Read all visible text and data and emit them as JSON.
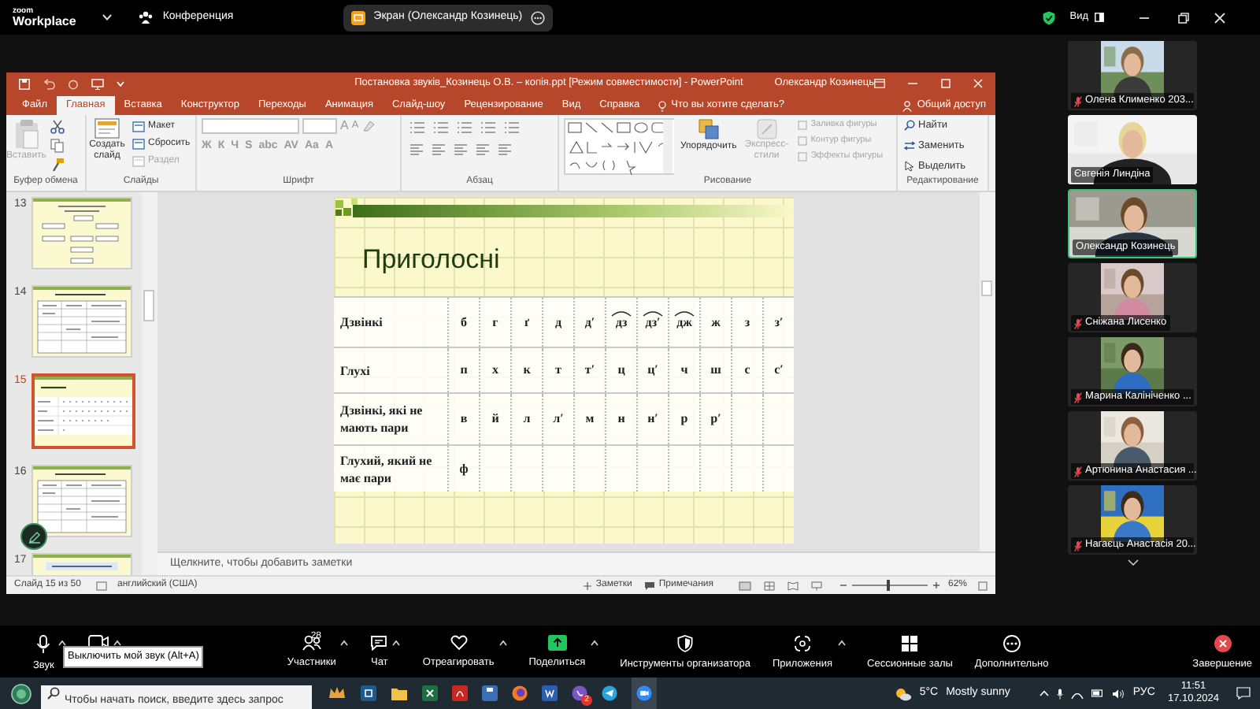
{
  "app_bar": {
    "logo_top": "zoom",
    "logo_bottom": "Workplace",
    "meeting_tab": "Конференция",
    "share_chip": "Экран (Олександр Козинець)",
    "view_button": "Вид"
  },
  "powerpoint": {
    "title": "Постановка звуків_Козинець О.В. – копія.ppt [Режим совместимости] - PowerPoint",
    "user": "Олександр Козинець",
    "tabs": [
      {
        "label": "Файл",
        "selected": false
      },
      {
        "label": "Главная",
        "selected": true
      },
      {
        "label": "Вставка",
        "selected": false
      },
      {
        "label": "Конструктор",
        "selected": false
      },
      {
        "label": "Переходы",
        "selected": false
      },
      {
        "label": "Анимация",
        "selected": false
      },
      {
        "label": "Слайд-шоу",
        "selected": false
      },
      {
        "label": "Рецензирование",
        "selected": false
      },
      {
        "label": "Вид",
        "selected": false
      },
      {
        "label": "Справка",
        "selected": false
      }
    ],
    "tell_me": "Что вы хотите сделать?",
    "share": "Общий доступ",
    "ribbon_groups": [
      {
        "kind": "clipboard",
        "label": "Буфер обмена",
        "paste": {
          "label": "Вставить",
          "disabled": true
        }
      },
      {
        "kind": "slides",
        "label": "Слайды",
        "new_slide": "Создать слайд",
        "items": [
          {
            "label": "Макет",
            "disabled": false
          },
          {
            "label": "Сбросить",
            "disabled": false
          },
          {
            "label": "Раздел",
            "disabled": true
          }
        ]
      },
      {
        "kind": "font",
        "label": "Шрифт",
        "size_buttons": [
          "A",
          "A"
        ],
        "format_buttons": [
          "Ж",
          "К",
          "Ч",
          "S",
          "abc",
          "AV",
          "Aa",
          "A"
        ]
      },
      {
        "kind": "paragraph",
        "label": "Абзац"
      },
      {
        "kind": "drawing",
        "label": "Рисование",
        "arrange": "Упорядочить",
        "quick_styles": {
          "label": "Экспресс-стили",
          "disabled": true
        },
        "items": [
          {
            "label": "Заливка фигуры",
            "disabled": true
          },
          {
            "label": "Контур фигуры",
            "disabled": true
          },
          {
            "label": "Эффекты фигуры",
            "disabled": true
          }
        ]
      },
      {
        "kind": "editing",
        "label": "Редактирование",
        "items": [
          {
            "label": "Найти",
            "disabled": false
          },
          {
            "label": "Заменить",
            "disabled": false
          },
          {
            "label": "Выделить",
            "disabled": false
          }
        ]
      }
    ],
    "thumbnails": [
      {
        "number": "13",
        "kind": "diagram",
        "selected": false
      },
      {
        "number": "14",
        "kind": "table",
        "selected": false
      },
      {
        "number": "15",
        "kind": "consonants",
        "selected": true
      },
      {
        "number": "16",
        "kind": "table",
        "selected": false
      },
      {
        "number": "17",
        "kind": "title",
        "selected": false
      }
    ],
    "slide": {
      "title": "Приголосні",
      "rows": [
        {
          "label": "Дзвінкі",
          "cells": [
            {
              "text": "б",
              "tie": false
            },
            {
              "text": "г",
              "tie": false
            },
            {
              "text": "ґ",
              "tie": false
            },
            {
              "text": "д",
              "tie": false
            },
            {
              "text": "д′",
              "tie": false
            },
            {
              "text": "дз",
              "tie": true
            },
            {
              "text": "дз′",
              "tie": true
            },
            {
              "text": "дж",
              "tie": true
            },
            {
              "text": "ж",
              "tie": false
            },
            {
              "text": "з",
              "tie": false
            },
            {
              "text": "з′",
              "tie": false
            }
          ]
        },
        {
          "label": "Глухі",
          "cells": [
            {
              "text": "п"
            },
            {
              "text": "х"
            },
            {
              "text": "к"
            },
            {
              "text": "т"
            },
            {
              "text": "т′"
            },
            {
              "text": "ц"
            },
            {
              "text": "ц′"
            },
            {
              "text": "ч"
            },
            {
              "text": "ш"
            },
            {
              "text": "с"
            },
            {
              "text": "с′"
            }
          ]
        },
        {
          "label": "Дзвінкі, які не мають пари",
          "cells": [
            {
              "text": "в"
            },
            {
              "text": "й"
            },
            {
              "text": "л"
            },
            {
              "text": "л′"
            },
            {
              "text": "м"
            },
            {
              "text": "н"
            },
            {
              "text": "н′"
            },
            {
              "text": "р"
            },
            {
              "text": "р′"
            }
          ]
        },
        {
          "label": "Глухий, який не має пари",
          "cells": [
            {
              "text": "ф"
            }
          ]
        }
      ]
    },
    "notes_placeholder": "Щелкните, чтобы добавить заметки",
    "status_bar": {
      "slide": "Слайд 15 из 50",
      "language": "английский (США)",
      "notes": "Заметки",
      "comments": "Примечания",
      "zoom": "62%",
      "level": 0.45
    }
  },
  "participants": [
    {
      "name": "Олена Клименко 203...",
      "kind": "portrait",
      "muted": true,
      "speaking": false
    },
    {
      "name": "Євгенія Линдіна",
      "kind": "wide",
      "muted": false,
      "speaking": false
    },
    {
      "name": "Олександр Козинець",
      "kind": "wide",
      "muted": false,
      "speaking": true
    },
    {
      "name": "Сніжана Лисенко",
      "kind": "portrait",
      "muted": true,
      "speaking": false
    },
    {
      "name": "Марина Калініченко ...",
      "kind": "portrait",
      "muted": true,
      "speaking": false
    },
    {
      "name": "Артюнина Анастасия ...",
      "kind": "portrait",
      "muted": true,
      "speaking": false
    },
    {
      "name": "Нагаєць Анастасія 20...",
      "kind": "portrait",
      "muted": true,
      "speaking": false
    }
  ],
  "toolbar": {
    "items": [
      {
        "kind": "mic",
        "label": "Звук",
        "caret": true
      },
      {
        "kind": "video",
        "caret": true
      },
      {
        "kind": "participants",
        "label": "Участники",
        "count": "28",
        "caret": true
      },
      {
        "kind": "chat",
        "label": "Чат",
        "caret": true
      },
      {
        "kind": "react",
        "label": "Отреагировать",
        "caret": true
      },
      {
        "kind": "share",
        "label": "Поделиться",
        "caret": true
      },
      {
        "kind": "host",
        "label": "Инструменты организатора",
        "caret": false
      },
      {
        "kind": "apps",
        "label": "Приложения",
        "caret": true
      },
      {
        "kind": "breakout",
        "label": "Сессионные залы",
        "caret": false
      },
      {
        "kind": "more",
        "label": "Дополнительно",
        "caret": false
      }
    ],
    "end": "Завершение",
    "tooltip": "Выключить мой звук (Alt+A)"
  },
  "taskbar": {
    "search": {
      "placeholder": "Чтобы начать поиск, введите здесь запрос"
    },
    "app_badge": "2",
    "temperature": "5°C",
    "weather": "Mostly sunny",
    "language": "РУС",
    "time": "11:51",
    "date": "17.10.2024"
  }
}
